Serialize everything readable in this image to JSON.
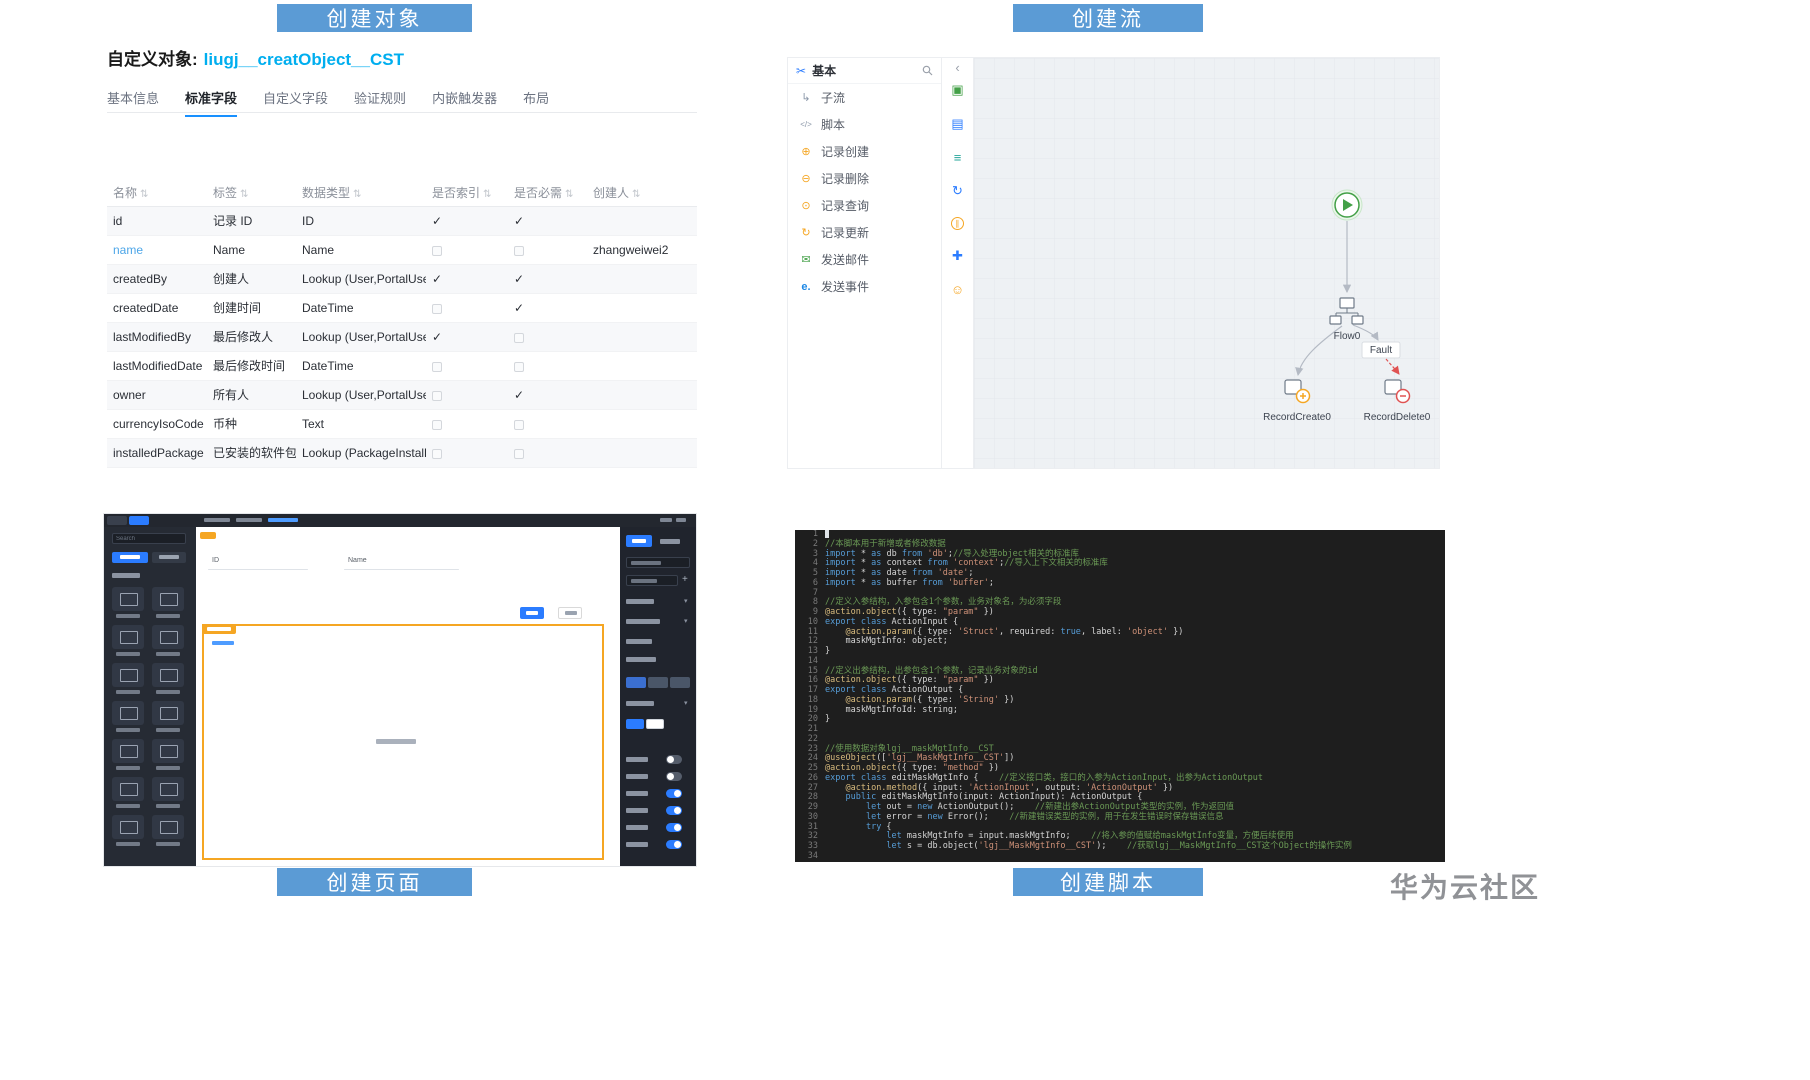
{
  "banners": {
    "top_left": "创建对象",
    "top_right": "创建流",
    "bottom_left": "创建页面",
    "bottom_right": "创建脚本"
  },
  "watermark": "华为云社区",
  "colors": {
    "banner_blue": "#5B9BD5",
    "accent_blue": "#1890FF",
    "object_name_cyan": "#00AEEF",
    "node_green": "#43A047",
    "node_orange": "#F5A623",
    "node_red": "#E05252"
  },
  "object_panel": {
    "title_label": "自定义对象:",
    "object_name": "liugj__creatObject__CST",
    "tabs": [
      {
        "label": "基本信息",
        "active": false
      },
      {
        "label": "标准字段",
        "active": true
      },
      {
        "label": "自定义字段",
        "active": false
      },
      {
        "label": "验证规则",
        "active": false
      },
      {
        "label": "内嵌触发器",
        "active": false
      },
      {
        "label": "布局",
        "active": false
      }
    ],
    "table": {
      "headers": [
        "名称",
        "标签",
        "数据类型",
        "是否索引",
        "是否必需",
        "创建人"
      ],
      "rows": [
        {
          "name": "id",
          "label": "记录 ID",
          "type": "ID",
          "indexed": true,
          "required": true,
          "creator": "",
          "link": false
        },
        {
          "name": "name",
          "label": "Name",
          "type": "Name",
          "indexed": false,
          "required": false,
          "creator": "zhangweiwei2",
          "link": true
        },
        {
          "name": "createdBy",
          "label": "创建人",
          "type": "Lookup (User,PortalUser)",
          "indexed": true,
          "required": true,
          "creator": "",
          "link": false
        },
        {
          "name": "createdDate",
          "label": "创建时间",
          "type": "DateTime",
          "indexed": false,
          "required": true,
          "creator": "",
          "link": false
        },
        {
          "name": "lastModifiedBy",
          "label": "最后修改人",
          "type": "Lookup (User,PortalUser)",
          "indexed": true,
          "required": false,
          "creator": "",
          "link": false
        },
        {
          "name": "lastModifiedDate",
          "label": "最后修改时间",
          "type": "DateTime",
          "indexed": false,
          "required": false,
          "creator": "",
          "link": false
        },
        {
          "name": "owner",
          "label": "所有人",
          "type": "Lookup (User,PortalUse...",
          "indexed": false,
          "required": true,
          "creator": "",
          "link": false
        },
        {
          "name": "currencyIsoCode",
          "label": "币种",
          "type": "Text",
          "indexed": false,
          "required": false,
          "creator": "",
          "link": false
        },
        {
          "name": "installedPackage",
          "label": "已安装的软件包",
          "type": "Lookup (PackageInstall)",
          "indexed": false,
          "required": false,
          "creator": "",
          "link": false
        }
      ]
    }
  },
  "flow_panel": {
    "sidebar": {
      "header": "基本",
      "items": [
        {
          "label": "子流",
          "icon": "subflow-icon"
        },
        {
          "label": "脚本",
          "icon": "script-icon"
        },
        {
          "label": "记录创建",
          "icon": "record-create-icon"
        },
        {
          "label": "记录删除",
          "icon": "record-delete-icon"
        },
        {
          "label": "记录查询",
          "icon": "record-query-icon"
        },
        {
          "label": "记录更新",
          "icon": "record-update-icon"
        },
        {
          "label": "发送邮件",
          "icon": "send-mail-icon"
        },
        {
          "label": "发送事件",
          "icon": "send-event-icon"
        }
      ]
    },
    "toolbar_icons": [
      "media-icon",
      "branch-icon",
      "list-icon",
      "loop-icon",
      "pause-icon",
      "move-icon",
      "emoji-icon"
    ],
    "nodes": {
      "flow": "Flow0",
      "fault": "Fault",
      "create": "RecordCreate0",
      "delete": "RecordDelete0"
    }
  },
  "page_panel": {
    "search_placeholder": "Search",
    "field_labels": [
      "ID",
      "Name"
    ],
    "toggles": [
      false,
      false,
      true,
      true,
      true,
      true
    ]
  },
  "script_panel": {
    "code_lines": [
      "",
      "//本脚本用于新增或者修改数据",
      "import * as db from 'db';//导入处理object相关的标准库",
      "import * as context from 'context';//导入上下文相关的标准库",
      "import * as date from 'date';",
      "import * as buffer from 'buffer';",
      "",
      "//定义入参结构，入参包含1个参数，业务对象名，为必须字段",
      "@action.object({ type: \"param\" })",
      "export class ActionInput {",
      "    @action.param({ type: 'Struct', required: true, label: 'object' })",
      "    maskMgtInfo: object;",
      "}",
      "",
      "//定义出参结构，出参包含1个参数，记录业务对象的id",
      "@action.object({ type: \"param\" })",
      "export class ActionOutput {",
      "    @action.param({ type: 'String' })",
      "    maskMgtInfoId: string;",
      "}",
      "",
      "",
      "//使用数据对象lgj__maskMgtInfo__CST",
      "@useObject(['lgj__MaskMgtInfo__CST'])",
      "@action.object({ type: \"method\" })",
      "export class editMaskMgtInfo {    //定义接口类，接口的入参为ActionInput，出参为ActionOutput",
      "    @action.method({ input: 'ActionInput', output: 'ActionOutput' })",
      "    public editMaskMgtInfo(input: ActionInput): ActionOutput {",
      "        let out = new ActionOutput();    //新建出参ActionOutput类型的实例，作为返回值",
      "        let error = new Error();    //新建错误类型的实例，用于在发生错误时保存错误信息",
      "        try {",
      "            let maskMgtInfo = input.maskMgtInfo;    //将入参的值赋给maskMgtInfo变量，方便后续使用",
      "            let s = db.object('lgj__MaskMgtInfo__CST');    //获取lgj__MaskMgtInfo__CST这个Object的操作实例",
      ""
    ]
  }
}
